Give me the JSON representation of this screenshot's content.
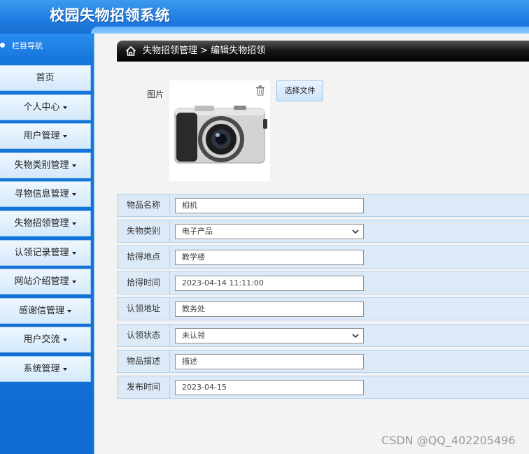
{
  "app": {
    "title": "校园失物招领系统"
  },
  "sidebar": {
    "nav_title": "栏目导航",
    "items": [
      {
        "label": "首页",
        "has_caret": false
      },
      {
        "label": "个人中心",
        "has_caret": true
      },
      {
        "label": "用户管理",
        "has_caret": true
      },
      {
        "label": "失物类别管理",
        "has_caret": true
      },
      {
        "label": "寻物信息管理",
        "has_caret": true
      },
      {
        "label": "失物招领管理",
        "has_caret": true
      },
      {
        "label": "认领记录管理",
        "has_caret": true
      },
      {
        "label": "网站介绍管理",
        "has_caret": true
      },
      {
        "label": "感谢信管理",
        "has_caret": true
      },
      {
        "label": "用户交流",
        "has_caret": true
      },
      {
        "label": "系统管理",
        "has_caret": true
      }
    ]
  },
  "breadcrumb": {
    "text": "失物招领管理 > 编辑失物招领"
  },
  "image_field": {
    "label": "图片",
    "choose_file_label": "选择文件"
  },
  "form": {
    "rows": [
      {
        "label": "物品名称",
        "type": "text",
        "value": "相机"
      },
      {
        "label": "失物类别",
        "type": "select",
        "value": "电子产品"
      },
      {
        "label": "拾得地点",
        "type": "text",
        "value": "教学楼"
      },
      {
        "label": "拾得时间",
        "type": "text",
        "value": "2023-04-14 11:11:00"
      },
      {
        "label": "认领地址",
        "type": "text",
        "value": "教务处"
      },
      {
        "label": "认领状态",
        "type": "select",
        "value": "未认领"
      },
      {
        "label": "物品描述",
        "type": "text",
        "value": "描述"
      },
      {
        "label": "发布时间",
        "type": "text",
        "value": "2023-04-15"
      }
    ]
  },
  "watermark": "CSDN @QQ_402205496",
  "colors": {
    "header": "#1f7be0",
    "sidebar": "#1778dc",
    "row_bg": "#dceaf8",
    "breadcrumb": "#000000"
  },
  "icons": {
    "home": "home-icon",
    "trash": "trash-icon",
    "select": "chevron-down-icon"
  }
}
